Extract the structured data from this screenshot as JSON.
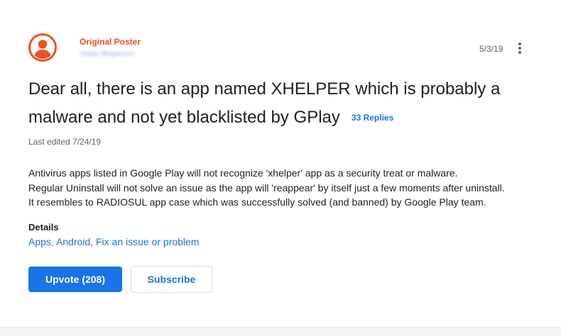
{
  "post": {
    "poster_label": "Original Poster",
    "poster_name": "Vasja Ilkapenon",
    "date": "5/3/19",
    "title": "Dear all, there is an app named XHELPER which is probably a malware and not yet blacklisted by GPlay",
    "replies": "33 Replies",
    "last_edited": "Last edited 7/24/19",
    "body": [
      "Antivirus apps listed in Google Play will not recognize 'xhelper' app as a security treat or malware.",
      "Regular Uninstall will not solve an issue as the app will 'reappear' by itself just a few moments after uninstall.",
      "It resembles to RADIOSUL app case which was successfully solved (and banned) by Google Play team."
    ]
  },
  "details": {
    "label": "Details",
    "links": [
      "Apps",
      "Android",
      "Fix an issue or problem"
    ],
    "separator": ", "
  },
  "actions": {
    "upvote_label": "Upvote (208)",
    "subscribe_label": "Subscribe"
  },
  "icons": {
    "avatar": "account-circle-icon",
    "more": "more-vert-icon"
  },
  "colors": {
    "accent": "#1a73e8",
    "poster_label": "#e8501c",
    "avatar": "#f0501e",
    "text": "#202124",
    "secondary_text": "#5f6368"
  }
}
